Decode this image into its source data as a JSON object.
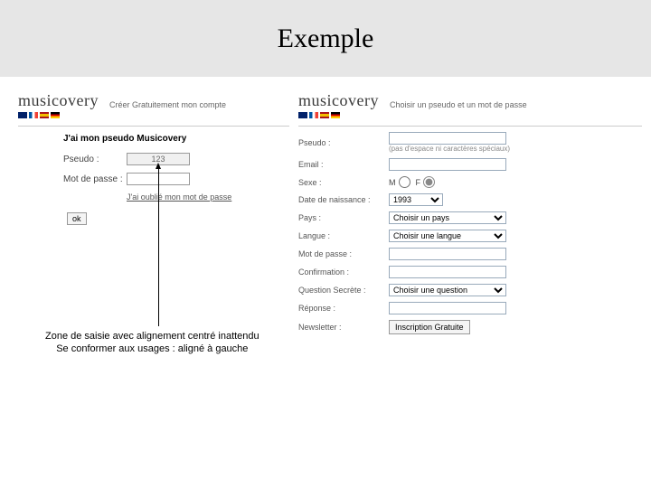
{
  "slide": {
    "title": "Exemple"
  },
  "logo": {
    "text": "musicovery"
  },
  "left": {
    "header_sub": "Créer Gratuitement mon compte",
    "title": "J'ai mon pseudo Musicovery",
    "pseudo_label": "Pseudo :",
    "pseudo_value": "123",
    "password_label": "Mot de passe :",
    "forgot": "J'ai oublié mon mot de passe",
    "ok": "ok"
  },
  "right": {
    "header_sub": "Choisir un pseudo et un mot de passe",
    "pseudo_label": "Pseudo :",
    "pseudo_hint": "(pas d'espace ni caractères spéciaux)",
    "email_label": "Email :",
    "sex_label": "Sexe :",
    "sex_m": "M",
    "sex_f": "F",
    "birth_label": "Date de naissance :",
    "birth_value": "1993",
    "country_label": "Pays :",
    "country_value": "Choisir un pays",
    "lang_label": "Langue :",
    "lang_value": "Choisir une langue",
    "pass_label": "Mot de passe :",
    "confirm_label": "Confirmation :",
    "question_label": "Question Secrète :",
    "question_value": "Choisir une question",
    "response_label": "Réponse :",
    "newsletter_label": "Newsletter :",
    "submit": "Inscription Gratuite"
  },
  "annotation": {
    "line1": "Zone de saisie avec alignement centré inattendu",
    "line2": "Se conformer aux usages : aligné à gauche"
  }
}
